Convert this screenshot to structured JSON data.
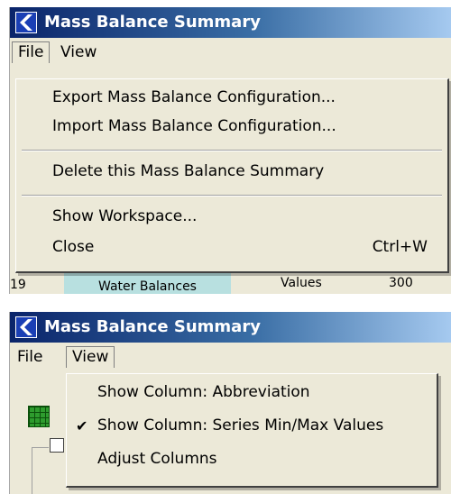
{
  "window": {
    "title": "Mass Balance Summary"
  },
  "menubar": {
    "file_label": "File",
    "view_label": "View"
  },
  "file_menu": {
    "items": [
      {
        "label": "Export Mass Balance Configuration..."
      },
      {
        "label": "Import Mass Balance Configuration..."
      },
      {
        "label": "Delete this Mass Balance Summary"
      },
      {
        "label": "Show Workspace..."
      },
      {
        "label": "Close",
        "shortcut": "Ctrl+W"
      }
    ]
  },
  "view_menu": {
    "items": [
      {
        "label": "Show Column: Abbreviation",
        "checked": false
      },
      {
        "label": "Show Column: Series Min/Max Values",
        "checked": true
      },
      {
        "label": "Adjust Columns",
        "checked": false
      }
    ]
  },
  "background_row": {
    "number": "19",
    "name": "Water Balances",
    "col2": "Values",
    "col3": "300"
  },
  "colors": {
    "title_start": "#0a246a",
    "title_end": "#a6caf0",
    "menu_bg": "#ece9d8",
    "cell_highlight": "#b8e0e0"
  }
}
